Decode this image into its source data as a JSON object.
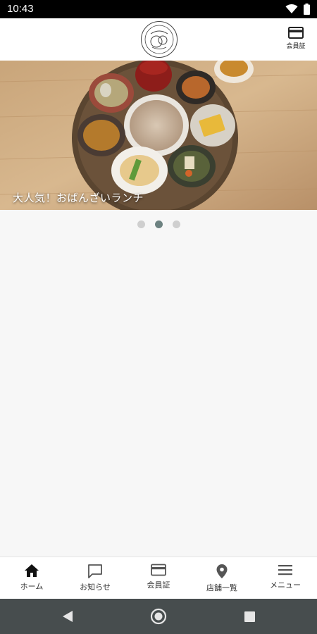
{
  "status_bar": {
    "time": "10:43",
    "icons": [
      "wifi-icon",
      "battery-icon"
    ]
  },
  "header": {
    "logo": "logo",
    "member_card": {
      "icon": "card-icon",
      "label": "会員証"
    }
  },
  "banner": {
    "caption": "大人気！おばんざいランチ",
    "slide_count": 3,
    "active_slide": 2
  },
  "bottom_nav": [
    {
      "icon": "home-icon",
      "label": "ホーム",
      "active": true
    },
    {
      "icon": "chat-icon",
      "label": "お知らせ"
    },
    {
      "icon": "card-icon",
      "label": "会員証"
    },
    {
      "icon": "location-pin-icon",
      "label": "店舗一覧"
    },
    {
      "icon": "menu-icon",
      "label": "メニュー"
    }
  ],
  "system_nav": [
    "back-icon",
    "home-circle-icon",
    "recents-icon"
  ],
  "colors": {
    "active_dot": "#6d8281",
    "inactive_dot": "#cfcfcf",
    "system_nav_bg": "#474d4e"
  }
}
